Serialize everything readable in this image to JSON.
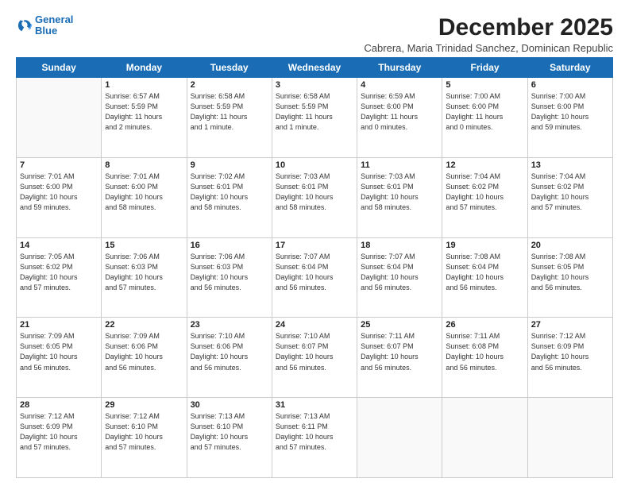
{
  "logo": {
    "line1": "General",
    "line2": "Blue"
  },
  "title": "December 2025",
  "subtitle": "Cabrera, Maria Trinidad Sanchez, Dominican Republic",
  "days_header": [
    "Sunday",
    "Monday",
    "Tuesday",
    "Wednesday",
    "Thursday",
    "Friday",
    "Saturday"
  ],
  "weeks": [
    [
      {
        "day": "",
        "info": ""
      },
      {
        "day": "1",
        "info": "Sunrise: 6:57 AM\nSunset: 5:59 PM\nDaylight: 11 hours\nand 2 minutes."
      },
      {
        "day": "2",
        "info": "Sunrise: 6:58 AM\nSunset: 5:59 PM\nDaylight: 11 hours\nand 1 minute."
      },
      {
        "day": "3",
        "info": "Sunrise: 6:58 AM\nSunset: 5:59 PM\nDaylight: 11 hours\nand 1 minute."
      },
      {
        "day": "4",
        "info": "Sunrise: 6:59 AM\nSunset: 6:00 PM\nDaylight: 11 hours\nand 0 minutes."
      },
      {
        "day": "5",
        "info": "Sunrise: 7:00 AM\nSunset: 6:00 PM\nDaylight: 11 hours\nand 0 minutes."
      },
      {
        "day": "6",
        "info": "Sunrise: 7:00 AM\nSunset: 6:00 PM\nDaylight: 10 hours\nand 59 minutes."
      }
    ],
    [
      {
        "day": "7",
        "info": "Sunrise: 7:01 AM\nSunset: 6:00 PM\nDaylight: 10 hours\nand 59 minutes."
      },
      {
        "day": "8",
        "info": "Sunrise: 7:01 AM\nSunset: 6:00 PM\nDaylight: 10 hours\nand 58 minutes."
      },
      {
        "day": "9",
        "info": "Sunrise: 7:02 AM\nSunset: 6:01 PM\nDaylight: 10 hours\nand 58 minutes."
      },
      {
        "day": "10",
        "info": "Sunrise: 7:03 AM\nSunset: 6:01 PM\nDaylight: 10 hours\nand 58 minutes."
      },
      {
        "day": "11",
        "info": "Sunrise: 7:03 AM\nSunset: 6:01 PM\nDaylight: 10 hours\nand 58 minutes."
      },
      {
        "day": "12",
        "info": "Sunrise: 7:04 AM\nSunset: 6:02 PM\nDaylight: 10 hours\nand 57 minutes."
      },
      {
        "day": "13",
        "info": "Sunrise: 7:04 AM\nSunset: 6:02 PM\nDaylight: 10 hours\nand 57 minutes."
      }
    ],
    [
      {
        "day": "14",
        "info": "Sunrise: 7:05 AM\nSunset: 6:02 PM\nDaylight: 10 hours\nand 57 minutes."
      },
      {
        "day": "15",
        "info": "Sunrise: 7:06 AM\nSunset: 6:03 PM\nDaylight: 10 hours\nand 57 minutes."
      },
      {
        "day": "16",
        "info": "Sunrise: 7:06 AM\nSunset: 6:03 PM\nDaylight: 10 hours\nand 56 minutes."
      },
      {
        "day": "17",
        "info": "Sunrise: 7:07 AM\nSunset: 6:04 PM\nDaylight: 10 hours\nand 56 minutes."
      },
      {
        "day": "18",
        "info": "Sunrise: 7:07 AM\nSunset: 6:04 PM\nDaylight: 10 hours\nand 56 minutes."
      },
      {
        "day": "19",
        "info": "Sunrise: 7:08 AM\nSunset: 6:04 PM\nDaylight: 10 hours\nand 56 minutes."
      },
      {
        "day": "20",
        "info": "Sunrise: 7:08 AM\nSunset: 6:05 PM\nDaylight: 10 hours\nand 56 minutes."
      }
    ],
    [
      {
        "day": "21",
        "info": "Sunrise: 7:09 AM\nSunset: 6:05 PM\nDaylight: 10 hours\nand 56 minutes."
      },
      {
        "day": "22",
        "info": "Sunrise: 7:09 AM\nSunset: 6:06 PM\nDaylight: 10 hours\nand 56 minutes."
      },
      {
        "day": "23",
        "info": "Sunrise: 7:10 AM\nSunset: 6:06 PM\nDaylight: 10 hours\nand 56 minutes."
      },
      {
        "day": "24",
        "info": "Sunrise: 7:10 AM\nSunset: 6:07 PM\nDaylight: 10 hours\nand 56 minutes."
      },
      {
        "day": "25",
        "info": "Sunrise: 7:11 AM\nSunset: 6:07 PM\nDaylight: 10 hours\nand 56 minutes."
      },
      {
        "day": "26",
        "info": "Sunrise: 7:11 AM\nSunset: 6:08 PM\nDaylight: 10 hours\nand 56 minutes."
      },
      {
        "day": "27",
        "info": "Sunrise: 7:12 AM\nSunset: 6:09 PM\nDaylight: 10 hours\nand 56 minutes."
      }
    ],
    [
      {
        "day": "28",
        "info": "Sunrise: 7:12 AM\nSunset: 6:09 PM\nDaylight: 10 hours\nand 57 minutes."
      },
      {
        "day": "29",
        "info": "Sunrise: 7:12 AM\nSunset: 6:10 PM\nDaylight: 10 hours\nand 57 minutes."
      },
      {
        "day": "30",
        "info": "Sunrise: 7:13 AM\nSunset: 6:10 PM\nDaylight: 10 hours\nand 57 minutes."
      },
      {
        "day": "31",
        "info": "Sunrise: 7:13 AM\nSunset: 6:11 PM\nDaylight: 10 hours\nand 57 minutes."
      },
      {
        "day": "",
        "info": ""
      },
      {
        "day": "",
        "info": ""
      },
      {
        "day": "",
        "info": ""
      }
    ]
  ]
}
